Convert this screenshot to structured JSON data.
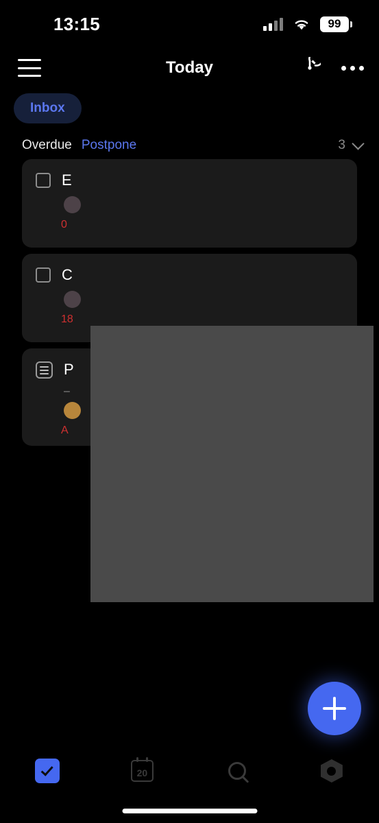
{
  "status_bar": {
    "time": "13:15",
    "battery_level": "99",
    "signal_icon": "cellular-signal-icon",
    "wifi_icon": "wifi-icon",
    "battery_icon": "battery-icon"
  },
  "nav_bar": {
    "menu_icon": "hamburger-menu-icon",
    "title": "Today",
    "edit_icon": "pencil-circle-icon",
    "overflow_icon": "more-options-icon"
  },
  "filter": {
    "chip_label": "Inbox",
    "chip_bg": "#16203a",
    "chip_text_color": "#5b77ef"
  },
  "section": {
    "title": "Overdue",
    "action_label": "Postpone",
    "count": "3",
    "chevron_icon": "chevron-down-icon",
    "action_color": "#5b77ef"
  },
  "tasks": [
    {
      "leading_icon": "checkbox-icon",
      "title": "E",
      "subtitle": "",
      "avatar_color": "#4d4248",
      "date": "0",
      "date_color": "#cf3030"
    },
    {
      "leading_icon": "checkbox-icon",
      "title": "C",
      "subtitle": "",
      "avatar_color": "#4d4248",
      "date": "18",
      "date_color": "#cf3030"
    },
    {
      "leading_icon": "checklist-icon",
      "title": "P",
      "subtitle": "–",
      "avatar_color": "#b8863b",
      "date": "A",
      "date_color": "#cf3030"
    }
  ],
  "overlay": {
    "name": "content-overlay",
    "color": "#4a4a4a"
  },
  "fab": {
    "icon": "plus-icon",
    "color": "#4568f0",
    "label": "Add task"
  },
  "tab_bar": {
    "items": [
      {
        "icon": "tasks-checkbox-icon",
        "label": "Tasks",
        "active": true
      },
      {
        "icon": "calendar-icon",
        "label": "Calendar",
        "day": "20",
        "active": false
      },
      {
        "icon": "search-icon",
        "label": "Search",
        "active": false
      },
      {
        "icon": "settings-gear-icon",
        "label": "Settings",
        "active": false
      }
    ],
    "active_color": "#4568f0"
  },
  "home_indicator": "home-indicator"
}
